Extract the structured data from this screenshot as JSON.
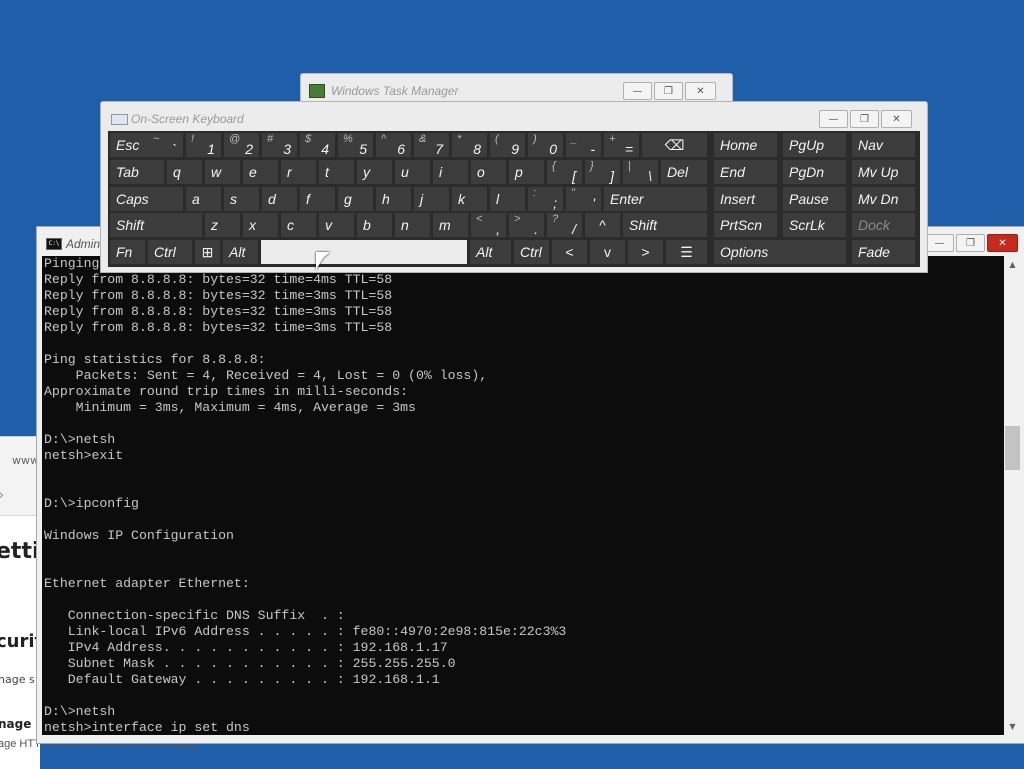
{
  "browser": {
    "url_fragment": "www",
    "heading": "ettir",
    "section_heading": "curit",
    "text_line": "nage s",
    "bold_line": "nage",
    "subline": "age HTTPS/SSL certificates and settings"
  },
  "task_manager": {
    "title": "Windows Task Manager"
  },
  "cmd": {
    "title": "Admin",
    "lines": [
      "Pinging",
      "Reply from 8.8.8.8: bytes=32 time=4ms TTL=58",
      "Reply from 8.8.8.8: bytes=32 time=3ms TTL=58",
      "Reply from 8.8.8.8: bytes=32 time=3ms TTL=58",
      "Reply from 8.8.8.8: bytes=32 time=3ms TTL=58",
      "",
      "Ping statistics for 8.8.8.8:",
      "    Packets: Sent = 4, Received = 4, Lost = 0 (0% loss),",
      "Approximate round trip times in milli-seconds:",
      "    Minimum = 3ms, Maximum = 4ms, Average = 3ms",
      "",
      "D:\\>netsh",
      "netsh>exit",
      "",
      "",
      "D:\\>ipconfig",
      "",
      "Windows IP Configuration",
      "",
      "",
      "Ethernet adapter Ethernet:",
      "",
      "   Connection-specific DNS Suffix  . :",
      "   Link-local IPv6 Address . . . . . : fe80::4970:2e98:815e:22c3%3",
      "   IPv4 Address. . . . . . . . . . . : 192.168.1.17",
      "   Subnet Mask . . . . . . . . . . . : 255.255.255.0",
      "   Default Gateway . . . . . . . . . : 192.168.1.1",
      "",
      "D:\\>netsh",
      "netsh>interface ip set dns"
    ]
  },
  "osk": {
    "title": "On-Screen Keyboard",
    "keys": {
      "esc": "Esc",
      "tilde_sh": "~",
      "tilde": "`",
      "d1s": "!",
      "d1": "1",
      "d2s": "@",
      "d2": "2",
      "d3s": "#",
      "d3": "3",
      "d4s": "$",
      "d4": "4",
      "d5s": "%",
      "d5": "5",
      "d6s": "^",
      "d6": "6",
      "d7s": "&",
      "d7": "7",
      "d8s": "*",
      "d8": "8",
      "d9s": "(",
      "d9": "9",
      "d0s": ")",
      "d0": "0",
      "minus_sh": "_",
      "minus": "-",
      "eq_sh": "+",
      "eq": "=",
      "backspace": "⌫",
      "tab": "Tab",
      "q": "q",
      "w": "w",
      "e": "e",
      "r": "r",
      "t": "t",
      "y": "y",
      "u": "u",
      "i": "i",
      "o": "o",
      "p": "p",
      "lb_sh": "{",
      "lb": "[",
      "rb_sh": "}",
      "rb": "]",
      "bs_sh": "|",
      "bs": "\\",
      "del": "Del",
      "caps": "Caps",
      "a": "a",
      "s": "s",
      "d": "d",
      "f": "f",
      "g": "g",
      "h": "h",
      "j": "j",
      "k": "k",
      "l": "l",
      "semi_sh": ":",
      "semi": ";",
      "quote_sh": "\"",
      "quote": "'",
      "enter": "Enter",
      "shift": "Shift",
      "z": "z",
      "x": "x",
      "c": "c",
      "v": "v",
      "b": "b",
      "n": "n",
      "m": "m",
      "comma_sh": "<",
      "comma": ",",
      "period_sh": ">",
      "period": ".",
      "slash_sh": "?",
      "slash": "/",
      "up": "^",
      "shift_r": "Shift",
      "fn": "Fn",
      "ctrl": "Ctrl",
      "win": "⊞",
      "alt": "Alt",
      "space": "",
      "alt_r": "Alt",
      "ctrl_r": "Ctrl",
      "left": "<",
      "down": "v",
      "right": ">",
      "menu": "☰",
      "home": "Home",
      "pgup": "PgUp",
      "nav": "Nav",
      "end": "End",
      "pgdn": "PgDn",
      "mvup": "Mv Up",
      "insert": "Insert",
      "pause": "Pause",
      "mvdn": "Mv Dn",
      "prtscn": "PrtScn",
      "scrlk": "ScrLk",
      "dock": "Dock",
      "options": "Options",
      "fade": "Fade"
    }
  },
  "window_buttons": {
    "minimize": "—",
    "maximize": "❐",
    "close": "✕"
  }
}
